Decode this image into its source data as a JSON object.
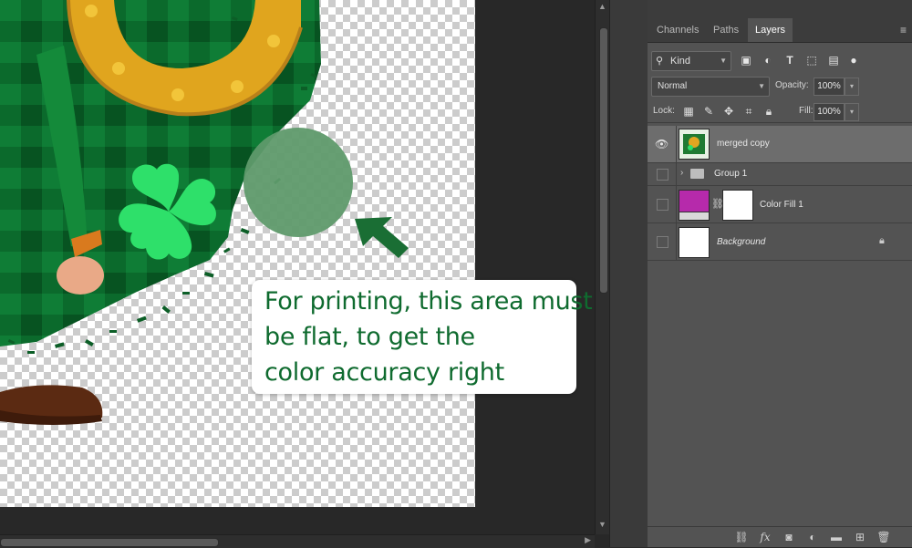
{
  "callout": {
    "line1": "For printing, this area must",
    "line2": "be flat, to get the",
    "line3": "color accuracy right"
  },
  "panel": {
    "tabs": [
      "Channels",
      "Paths",
      "Layers"
    ],
    "active_tab": "Layers",
    "filter_kind": "Kind",
    "blend_mode": "Normal",
    "opacity_label": "Opacity:",
    "opacity_value": "100%",
    "lock_label": "Lock:",
    "fill_label": "Fill:",
    "fill_value": "100%",
    "layers": [
      {
        "name": "merged copy",
        "visible": true,
        "selected": true
      },
      {
        "name": "Group 1",
        "visible": false,
        "selected": false
      },
      {
        "name": "Color Fill 1",
        "visible": false,
        "selected": false
      },
      {
        "name": "Background",
        "visible": false,
        "selected": false,
        "locked": true
      }
    ]
  },
  "colors": {
    "callout_text": "#0f6b2f",
    "arrow": "#1a6e34",
    "clover": "#2ee06a",
    "fill_swatch": "#b62aab"
  },
  "icons": [
    "eye-icon",
    "folder-icon",
    "lock-icon",
    "link-icon",
    "trash-icon"
  ]
}
